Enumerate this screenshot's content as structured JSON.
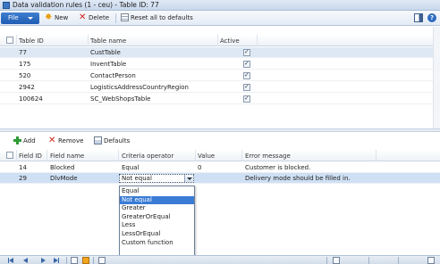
{
  "window": {
    "title": "Data validation rules (1 - ceu) - Table ID: 77"
  },
  "toolbar": {
    "file_label": "File",
    "new_label": "New",
    "delete_label": "Delete",
    "reset_label": "Reset all to defaults"
  },
  "tables_grid": {
    "columns": [
      "Table ID",
      "Table name",
      "Active"
    ],
    "rows": [
      {
        "id": "77",
        "name": "CustTable",
        "active": true
      },
      {
        "id": "175",
        "name": "InventTable",
        "active": true
      },
      {
        "id": "520",
        "name": "ContactPerson",
        "active": true
      },
      {
        "id": "2942",
        "name": "LogisticsAddressCountryRegion",
        "active": true
      },
      {
        "id": "100624",
        "name": "SC_WebShopsTable",
        "active": true
      }
    ]
  },
  "lines_toolbar": {
    "add_label": "Add",
    "remove_label": "Remove",
    "defaults_label": "Defaults"
  },
  "rules_grid": {
    "columns": [
      "Field ID",
      "Field name",
      "Criteria operator",
      "Value",
      "Error message"
    ],
    "rows": [
      {
        "field_id": "14",
        "field_name": "Blocked",
        "operator": "Equal",
        "value": "0",
        "error": "Customer is blocked."
      },
      {
        "field_id": "29",
        "field_name": "DlvMode",
        "operator": "Not equal",
        "value": "",
        "error": "Delivery mode should be filled in."
      }
    ]
  },
  "operator_dropdown": {
    "options": [
      "Equal",
      "Not equal",
      "Greater",
      "GreaterOrEqual",
      "Less",
      "LessOrEqual",
      "Custom function"
    ],
    "highlighted": "Not equal"
  },
  "colors": {
    "accent": "#1f5cb2",
    "selection": "#3a7bd5",
    "row_selected": "#dde8f4"
  },
  "icons": [
    "new-star-icon",
    "delete-x-icon",
    "reset-grid-icon",
    "panel-icon",
    "help-icon",
    "add-plus-icon",
    "remove-x-icon",
    "defaults-icon"
  ]
}
